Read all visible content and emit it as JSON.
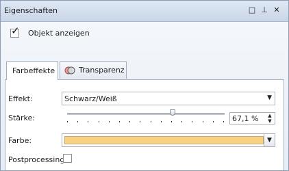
{
  "window": {
    "title": "Eigenschaften",
    "buttons": [
      "□",
      "⊥",
      "✕"
    ]
  },
  "show_object": {
    "label": "Objekt anzeigen",
    "checked": true
  },
  "tabs": [
    {
      "label": "Farbeffekte",
      "active": true
    },
    {
      "label": "Transparenz",
      "active": false,
      "icon": "transparency-icon"
    }
  ],
  "effect": {
    "label": "Effekt:",
    "value": "Schwarz/Weiß"
  },
  "strength": {
    "label": "Stärke:",
    "value": "67,1 %",
    "slider_fraction": 0.671
  },
  "color": {
    "label": "Farbe:",
    "value_color": "#f9d185"
  },
  "postprocessing": {
    "label": "Postprocessing",
    "checked": false
  }
}
